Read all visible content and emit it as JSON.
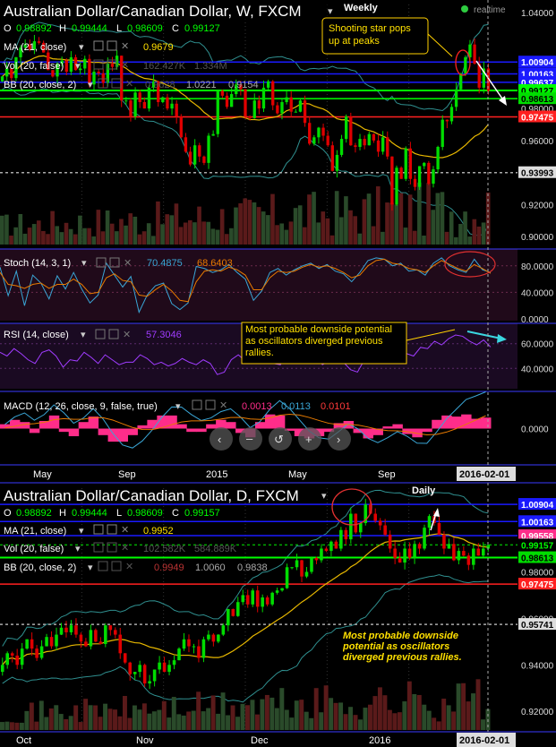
{
  "colors": {
    "background": "#000000",
    "grid": "#333333",
    "up": "#00dd00",
    "down": "#e00000",
    "volume": "#2a4a2a",
    "volume_down": "#5a1a1a",
    "ma": "#e8b800",
    "bb": "#2f8f8f",
    "level_blue": "#1a1aff",
    "level_green": "#00ff00",
    "level_red": "#ff2020",
    "stoch_k": "#3aa6d6",
    "stoch_d": "#e87a00",
    "rsi": "#a03cff",
    "macd_hist": "#ff2d8a",
    "macd_line": "#3aa6d6",
    "signal_line": "#e87a00",
    "panel_tint": "#2a0a2a",
    "note_bg": "#000000",
    "note_text": "#ffe000",
    "note_border": "#ffd000"
  },
  "weekly": {
    "title": "Australian Dollar/Canadian Dollar, W, FXCM",
    "timeframe_label": "Weekly",
    "realtime": "realtime",
    "ohlc": {
      "o_label": "O",
      "o": "0.98892",
      "h_label": "H",
      "h": "0.99444",
      "l_label": "L",
      "l": "0.98609",
      "c_label": "C",
      "c": "0.99127"
    },
    "ma": {
      "label": "MA (21, close)",
      "value": "0.9679"
    },
    "vol": {
      "label": "Vol (20, false)",
      "v1": "162.427K",
      "v2": "1.334M"
    },
    "bb": {
      "label": "BB (20, close, 2)",
      "v1": "0.9628",
      "v2": "1.0221",
      "v3": "0.9154"
    },
    "annotation": "Shooting star pops up at peaks",
    "price_labels": [
      "1.04000",
      "1.00904",
      "1.00163",
      "0.99637",
      "0.99127",
      "0.98000",
      "0.98613",
      "0.97475",
      "0.96000",
      "0.93993",
      "0.92000",
      "0.90000"
    ],
    "stoch": {
      "label": "Stoch (14, 3, 1)",
      "k": "70.4875",
      "d": "68.6403",
      "ticks": [
        "80.0000",
        "40.0000",
        "0.0000"
      ]
    },
    "rsi": {
      "label": "RSI (14, close)",
      "value": "57.3046",
      "ticks": [
        "60.0000",
        "40.0000"
      ]
    },
    "rsi_note": "Most probable downside potential as oscillators diverged previous rallies.",
    "macd": {
      "label": "MACD (12, 26, close, 9, false, true)",
      "v1": "0.0013",
      "v2": "0.0113",
      "v3": "0.0101",
      "ticks": [
        "0.0000"
      ]
    },
    "x_ticks": [
      "May",
      "Sep",
      "2015",
      "May",
      "Sep"
    ],
    "x_current": "2016-02-01"
  },
  "daily": {
    "title": "Australian Dollar/Canadian Dollar, D, FXCM",
    "timeframe_label": "Daily",
    "ohlc": {
      "o_label": "O",
      "o": "0.98892",
      "h_label": "H",
      "h": "0.99444",
      "l_label": "L",
      "l": "0.98609",
      "c_label": "C",
      "c": "0.99157"
    },
    "ma": {
      "label": "MA (21, close)",
      "value": "0.9952"
    },
    "vol": {
      "label": "Vol (20, false)",
      "v1": "102.582K",
      "v2": "584.889K"
    },
    "bb": {
      "label": "BB (20, close, 2)",
      "v1": "0.9949",
      "v2": "1.0060",
      "v3": "0.9838"
    },
    "note": "Most probable downside potential as oscillators diverged previous rallies.",
    "price_labels": [
      "1.00904",
      "1.00163",
      "0.99558",
      "0.99157",
      "0.98613",
      "0.98000",
      "0.97475",
      "0.96000",
      "0.95741",
      "0.94000",
      "0.92000"
    ],
    "x_ticks": [
      "Oct",
      "Nov",
      "Dec",
      "2016"
    ],
    "x_current": "2016-02-01"
  },
  "chart_data": [
    {
      "type": "candlestick",
      "title": "Australian Dollar/Canadian Dollar, W, FXCM",
      "ylim": [
        0.895,
        1.045
      ],
      "x_ticks": [
        "May",
        "Sep",
        "2015",
        "May",
        "Sep"
      ],
      "levels": [
        1.00904,
        1.00163,
        0.99637,
        0.99127,
        0.98613,
        0.97475,
        0.93993
      ],
      "close": [
        1.0,
        1.005,
        0.999,
        1.012,
        1.018,
        1.02,
        1.017,
        1.022,
        1.021,
        1.015,
        1.004,
        1.0,
        1.008,
        1.01,
        1.003,
        1.012,
        1.004,
        1.005,
        1.011,
        0.995,
        1.003,
        1.002,
        0.996,
        1.008,
        1.006,
        1.013,
        0.985,
        0.985,
        0.975,
        0.99,
        0.984,
        0.98,
        0.993,
        0.997,
        0.984,
        0.987,
        0.98,
        0.983,
        0.975,
        0.962,
        0.953,
        0.945,
        0.957,
        0.95,
        0.946,
        0.963,
        0.964,
        0.991,
        0.988,
        0.981,
        0.989,
        0.995,
        0.992,
        0.975,
        0.974,
        0.985,
        0.98,
        0.993,
        0.997,
        0.982,
        0.977,
        0.984,
        0.987,
        0.978,
        0.978,
        0.985,
        0.971,
        0.958,
        0.962,
        0.968,
        0.963,
        0.957,
        0.941,
        0.951,
        0.961,
        0.975,
        0.957,
        0.956,
        0.961,
        0.957,
        0.964,
        0.96,
        0.953,
        0.962,
        0.95,
        0.92,
        0.943,
        0.936,
        0.955,
        0.936,
        0.931,
        0.944,
        0.946,
        0.933,
        0.942,
        0.956,
        0.973,
        0.972,
        0.981,
        0.992,
        1.002,
        1.012,
        1.02,
        1.008,
        0.993,
        1.005,
        0.991
      ]
    },
    {
      "type": "line",
      "title": "Stoch (14, 3, 1)",
      "ylim": [
        0,
        100
      ],
      "series": [
        {
          "name": "%K",
          "values": [
            78,
            35,
            72,
            20,
            66,
            54,
            30,
            65,
            45,
            70,
            45,
            24,
            36,
            84,
            66,
            48,
            64,
            10,
            36,
            50,
            54,
            23,
            14,
            24,
            79,
            76,
            70,
            74,
            82,
            70,
            60,
            28,
            42,
            70,
            76,
            66,
            74,
            80,
            84,
            76,
            82,
            72,
            68,
            56,
            70,
            88,
            92,
            90,
            80,
            84,
            72,
            74,
            66,
            84,
            92,
            80,
            74,
            70,
            90,
            74,
            70
          ]
        },
        {
          "name": "%D",
          "values": [
            70,
            52,
            50,
            46,
            52,
            54,
            46,
            52,
            52,
            60,
            52,
            38,
            40,
            62,
            68,
            58,
            56,
            36,
            34,
            44,
            52,
            42,
            28,
            26,
            56,
            72,
            74,
            72,
            78,
            74,
            66,
            44,
            44,
            62,
            72,
            70,
            72,
            78,
            82,
            78,
            80,
            76,
            70,
            62,
            66,
            80,
            88,
            90,
            84,
            82,
            76,
            74,
            70,
            80,
            88,
            82,
            76,
            72,
            82,
            76,
            68.6
          ]
        }
      ]
    },
    {
      "type": "line",
      "title": "RSI (14, close)",
      "ylim": [
        25,
        75
      ],
      "series": [
        {
          "name": "RSI",
          "values": [
            53,
            50,
            56,
            52,
            47,
            44,
            53,
            55,
            50,
            41,
            47,
            46,
            53,
            49,
            44,
            51,
            47,
            43,
            45,
            45,
            51,
            48,
            43,
            45,
            42,
            44,
            48,
            45,
            43,
            47,
            44,
            35,
            37,
            47,
            51,
            46,
            52,
            50,
            55,
            44,
            43,
            51,
            49,
            44,
            53,
            50,
            43,
            46,
            58,
            45,
            39,
            37,
            47,
            44,
            55,
            51,
            46,
            50,
            52,
            50,
            57,
            56,
            62,
            59,
            64,
            67,
            66,
            62,
            59,
            63,
            57.3
          ]
        }
      ]
    },
    {
      "type": "area",
      "title": "MACD (12, 26, close, 9, false, true)",
      "ylim": [
        -0.03,
        0.03
      ],
      "series": [
        {
          "name": "histogram",
          "values": [
            0.004,
            0.008,
            0.006,
            -0.004,
            0.007,
            0.012,
            -0.003,
            -0.007,
            0.006,
            0.011,
            -0.006,
            -0.012,
            -0.012,
            -0.006,
            0.003,
            0.008,
            0.012,
            0.012,
            0.004,
            -0.003,
            -0.003,
            0.004,
            0.008,
            0.006,
            -0.004,
            -0.008,
            0.006,
            0.013,
            0.012,
            -0.002,
            -0.007,
            -0.009,
            -0.007,
            -0.003,
            0.005,
            0.007,
            -0.004,
            -0.009,
            -0.006,
            0.002,
            0.004,
            -0.005,
            -0.008,
            -0.003,
            0.008,
            0.012,
            0.011,
            0.013,
            0.009,
            0.0101
          ]
        }
      ]
    },
    {
      "type": "candlestick",
      "title": "Australian Dollar/Canadian Dollar, D, FXCM",
      "ylim": [
        0.912,
        1.016
      ],
      "x_ticks": [
        "Oct",
        "Nov",
        "Dec",
        "2016"
      ],
      "levels": [
        1.00904,
        1.00163,
        0.99558,
        0.99157,
        0.98613,
        0.97475,
        0.95741
      ],
      "close": [
        0.94,
        0.945,
        0.944,
        0.94,
        0.947,
        0.951,
        0.947,
        0.943,
        0.948,
        0.952,
        0.948,
        0.953,
        0.956,
        0.954,
        0.957,
        0.953,
        0.95,
        0.948,
        0.955,
        0.95,
        0.949,
        0.957,
        0.955,
        0.953,
        0.945,
        0.941,
        0.936,
        0.937,
        0.94,
        0.932,
        0.933,
        0.938,
        0.941,
        0.937,
        0.94,
        0.942,
        0.947,
        0.951,
        0.948,
        0.948,
        0.943,
        0.951,
        0.953,
        0.95,
        0.953,
        0.957,
        0.964,
        0.961,
        0.967,
        0.97,
        0.966,
        0.972,
        0.965,
        0.969,
        0.966,
        0.971,
        0.972,
        0.973,
        0.982,
        0.982,
        0.985,
        0.978,
        0.98,
        0.986,
        0.985,
        0.99,
        0.989,
        0.993,
        0.99,
        0.998,
        0.994,
        1.005,
        0.997,
        1.001,
        1.009,
        1.005,
        1.002,
        1.0,
        0.996,
        0.99,
        0.986,
        0.984,
        0.99,
        0.986,
        0.992,
        0.99,
        0.999,
        1.004,
        1.001,
        0.996,
        0.99,
        0.992,
        0.985,
        0.989,
        0.987,
        0.983,
        0.99,
        0.987,
        0.99,
        0.99157
      ]
    }
  ]
}
